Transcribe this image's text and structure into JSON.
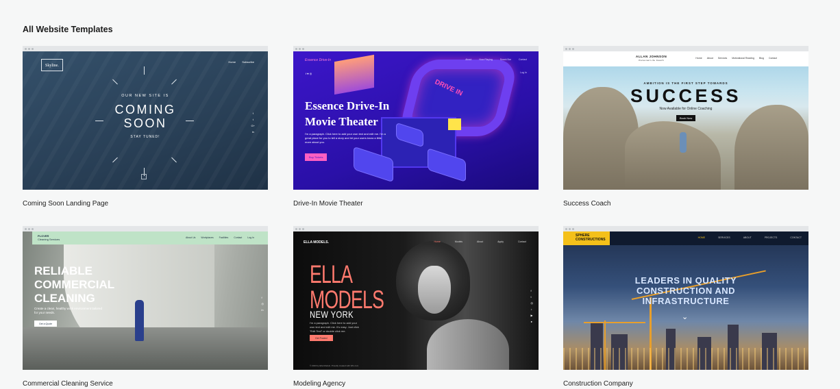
{
  "page": {
    "heading": "All Website Templates"
  },
  "templates": [
    {
      "label": "Coming Soon Landing Page",
      "preview": {
        "logo": "Skyline.",
        "nav": [
          "Home",
          "Subscribe"
        ],
        "kicker": "OUR NEW SITE IS",
        "headline_1": "COMING",
        "headline_2": "SOON",
        "footer": "STAY TUNED!",
        "social": [
          "f",
          "t",
          "G+",
          "in"
        ]
      }
    },
    {
      "label": "Drive-In Movie Theater",
      "preview": {
        "brand": "Essence Drive-In",
        "nav": [
          "About",
          "Now Playing",
          "Snack Bar",
          "Contact"
        ],
        "social": "f ♥ ◎",
        "login": "Log In",
        "sign": "DRIVE IN",
        "title_1": "Essence Drive-In",
        "title_2": "Movie Theater",
        "paragraph": "I'm a paragraph. Click here to add your own text and edit me. I'm a great place for you to tell a story and let your users know a little more about you.",
        "button": "Buy Tickets"
      }
    },
    {
      "label": "Success Coach",
      "preview": {
        "name": "ALLAN JOHNSON",
        "subname": "Personal Life Coach",
        "nav": [
          "Home",
          "About",
          "Services",
          "Motivational Reading",
          "Blog",
          "Contact"
        ],
        "tagline": "AMBITION IS THE FIRST STEP TOWARDS",
        "headline": "SUCCESS",
        "availability": "Now Available for Online Coaching",
        "button": "Book Now"
      }
    },
    {
      "label": "Commercial Cleaning Service",
      "preview": {
        "logo_name": "PLOVER",
        "logo_sub": "Cleaning Services",
        "nav": [
          "About Us",
          "Workplaces",
          "Facilities",
          "Contact",
          "Log In"
        ],
        "title_1": "RELIABLE",
        "title_2": "COMMERCIAL",
        "title_3": "CLEANING",
        "paragraph": "Create a clean, healthy work environment tailored for your needs.",
        "button": "Get a Quote",
        "social": [
          "f",
          "◎",
          "in"
        ]
      }
    },
    {
      "label": "Modeling Agency",
      "preview": {
        "brand": "ELLA MODELS.",
        "nav": [
          "Home",
          "Models",
          "About",
          "Apply",
          "Contact"
        ],
        "title_1": "ELLA",
        "title_2": "MODELS",
        "city": "NEW YORK",
        "paragraph": "I'm a paragraph. Click here to add your own text and edit me. It's easy. Just click \"Edit Text\" or double click me.",
        "button": "Get Posted",
        "social": [
          "f",
          "t",
          "◎",
          "♪",
          "▶",
          "●"
        ],
        "footer": "© 2023 by Ella Models. Proudly created with Wix.com"
      }
    },
    {
      "label": "Construction Company",
      "preview": {
        "logo_1": "SPHERE",
        "logo_2": "CONSTRUCTIONS",
        "nav": [
          "HOME",
          "SERVICES",
          "ABOUT",
          "PROJECTS",
          "CONTACT"
        ],
        "title_1": "LEADERS IN QUALITY",
        "title_2": "CONSTRUCTION AND",
        "title_3": "INFRASTRUCTURE",
        "chevron": "⌄"
      }
    }
  ]
}
